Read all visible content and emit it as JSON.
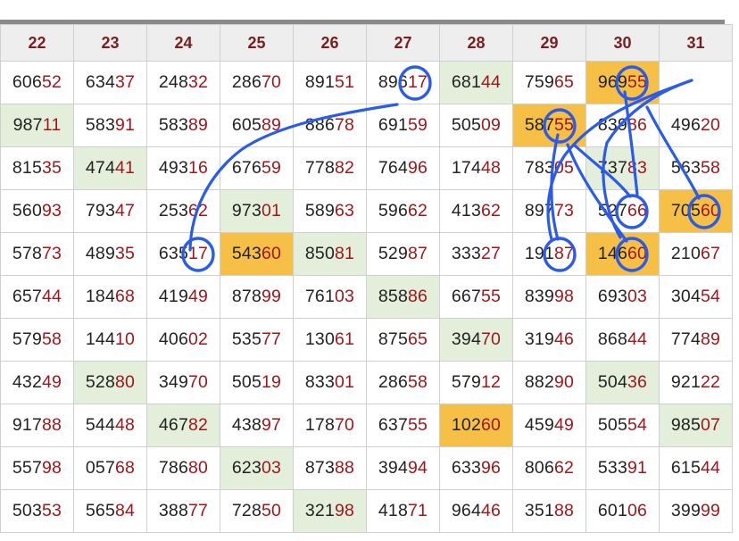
{
  "columns": [
    "22",
    "23",
    "24",
    "25",
    "26",
    "27",
    "28",
    "29",
    "30",
    "31"
  ],
  "rows": [
    [
      {
        "h": "606",
        "t": "52"
      },
      {
        "h": "634",
        "t": "37"
      },
      {
        "h": "248",
        "t": "32"
      },
      {
        "h": "286",
        "t": "70"
      },
      {
        "h": "891",
        "t": "51"
      },
      {
        "h": "896",
        "t": "17"
      },
      {
        "h": "681",
        "t": "44",
        "bg": "green"
      },
      {
        "h": "759",
        "t": "65"
      },
      {
        "h": "969",
        "t": "55",
        "bg": "orange"
      },
      {
        "h": "",
        "t": ""
      }
    ],
    [
      {
        "h": "987",
        "t": "11",
        "bg": "green"
      },
      {
        "h": "583",
        "t": "91"
      },
      {
        "h": "583",
        "t": "89"
      },
      {
        "h": "605",
        "t": "89"
      },
      {
        "h": "886",
        "t": "78"
      },
      {
        "h": "691",
        "t": "59"
      },
      {
        "h": "505",
        "t": "09"
      },
      {
        "h": "587",
        "t": "55",
        "bg": "orange"
      },
      {
        "h": "839",
        "t": "86"
      },
      {
        "h": "496",
        "t": "20"
      }
    ],
    [
      {
        "h": "815",
        "t": "35"
      },
      {
        "h": "474",
        "t": "41",
        "bg": "green"
      },
      {
        "h": "493",
        "t": "16"
      },
      {
        "h": "676",
        "t": "59"
      },
      {
        "h": "778",
        "t": "82"
      },
      {
        "h": "764",
        "t": "96"
      },
      {
        "h": "174",
        "t": "48"
      },
      {
        "h": "783",
        "t": "05"
      },
      {
        "h": "737",
        "t": "83",
        "bg": "green"
      },
      {
        "h": "563",
        "t": "58"
      }
    ],
    [
      {
        "h": "560",
        "t": "93"
      },
      {
        "h": "793",
        "t": "47"
      },
      {
        "h": "253",
        "t": "62"
      },
      {
        "h": "973",
        "t": "01",
        "bg": "green"
      },
      {
        "h": "589",
        "t": "63"
      },
      {
        "h": "596",
        "t": "62"
      },
      {
        "h": "413",
        "t": "62"
      },
      {
        "h": "897",
        "t": "73"
      },
      {
        "h": "527",
        "t": "66"
      },
      {
        "h": "705",
        "t": "60",
        "bg": "orange"
      }
    ],
    [
      {
        "h": "578",
        "t": "73"
      },
      {
        "h": "489",
        "t": "35"
      },
      {
        "h": "635",
        "t": "17"
      },
      {
        "h": "543",
        "t": "60",
        "bg": "orange"
      },
      {
        "h": "850",
        "t": "81",
        "bg": "green"
      },
      {
        "h": "529",
        "t": "87"
      },
      {
        "h": "333",
        "t": "27"
      },
      {
        "h": "191",
        "t": "87"
      },
      {
        "h": "146",
        "t": "60",
        "bg": "orange"
      },
      {
        "h": "210",
        "t": "67"
      }
    ],
    [
      {
        "h": "657",
        "t": "44"
      },
      {
        "h": "184",
        "t": "68"
      },
      {
        "h": "419",
        "t": "49"
      },
      {
        "h": "878",
        "t": "99"
      },
      {
        "h": "761",
        "t": "03"
      },
      {
        "h": "858",
        "t": "86",
        "bg": "green"
      },
      {
        "h": "667",
        "t": "55"
      },
      {
        "h": "839",
        "t": "98"
      },
      {
        "h": "693",
        "t": "03"
      },
      {
        "h": "304",
        "t": "54"
      }
    ],
    [
      {
        "h": "579",
        "t": "58"
      },
      {
        "h": "144",
        "t": "10"
      },
      {
        "h": "406",
        "t": "02"
      },
      {
        "h": "535",
        "t": "77"
      },
      {
        "h": "130",
        "t": "61"
      },
      {
        "h": "875",
        "t": "65"
      },
      {
        "h": "394",
        "t": "70",
        "bg": "green"
      },
      {
        "h": "319",
        "t": "46"
      },
      {
        "h": "868",
        "t": "44"
      },
      {
        "h": "774",
        "t": "89"
      }
    ],
    [
      {
        "h": "432",
        "t": "49"
      },
      {
        "h": "528",
        "t": "80",
        "bg": "green"
      },
      {
        "h": "349",
        "t": "70"
      },
      {
        "h": "505",
        "t": "19"
      },
      {
        "h": "833",
        "t": "01"
      },
      {
        "h": "286",
        "t": "58"
      },
      {
        "h": "579",
        "t": "12"
      },
      {
        "h": "882",
        "t": "90"
      },
      {
        "h": "504",
        "t": "36",
        "bg": "green"
      },
      {
        "h": "921",
        "t": "22"
      }
    ],
    [
      {
        "h": "917",
        "t": "88"
      },
      {
        "h": "544",
        "t": "48"
      },
      {
        "h": "467",
        "t": "82",
        "bg": "green"
      },
      {
        "h": "438",
        "t": "97"
      },
      {
        "h": "178",
        "t": "70"
      },
      {
        "h": "637",
        "t": "55"
      },
      {
        "h": "102",
        "t": "60",
        "bg": "orange"
      },
      {
        "h": "459",
        "t": "49"
      },
      {
        "h": "505",
        "t": "54"
      },
      {
        "h": "985",
        "t": "07",
        "bg": "green"
      }
    ],
    [
      {
        "h": "557",
        "t": "98"
      },
      {
        "h": "057",
        "t": "68"
      },
      {
        "h": "786",
        "t": "80"
      },
      {
        "h": "623",
        "t": "03",
        "bg": "green"
      },
      {
        "h": "873",
        "t": "88"
      },
      {
        "h": "394",
        "t": "94"
      },
      {
        "h": "633",
        "t": "96"
      },
      {
        "h": "806",
        "t": "62"
      },
      {
        "h": "533",
        "t": "91"
      },
      {
        "h": "615",
        "t": "44"
      }
    ],
    [
      {
        "h": "503",
        "t": "53"
      },
      {
        "h": "565",
        "t": "84"
      },
      {
        "h": "388",
        "t": "77"
      },
      {
        "h": "728",
        "t": "50"
      },
      {
        "h": "321",
        "t": "98",
        "bg": "green"
      },
      {
        "h": "418",
        "t": "71"
      },
      {
        "h": "964",
        "t": "46"
      },
      {
        "h": "351",
        "t": "88"
      },
      {
        "h": "601",
        "t": "06"
      },
      {
        "h": "399",
        "t": "99"
      }
    ]
  ],
  "colors": {
    "green": "#e3efdb",
    "orange": "#f6c046",
    "tail": "#a0161a",
    "header": "#7a1f1f",
    "annotation": "#2a5bea"
  },
  "annotations": [
    {
      "type": "circle",
      "row": 0,
      "col": 5
    },
    {
      "type": "circle",
      "row": 0,
      "col": 8
    },
    {
      "type": "circle",
      "row": 1,
      "col": 7
    },
    {
      "type": "circle",
      "row": 3,
      "col": 8
    },
    {
      "type": "circle",
      "row": 3,
      "col": 9
    },
    {
      "type": "circle",
      "row": 4,
      "col": 2
    },
    {
      "type": "circle",
      "row": 4,
      "col": 7
    },
    {
      "type": "circle",
      "row": 4,
      "col": 8
    }
  ]
}
